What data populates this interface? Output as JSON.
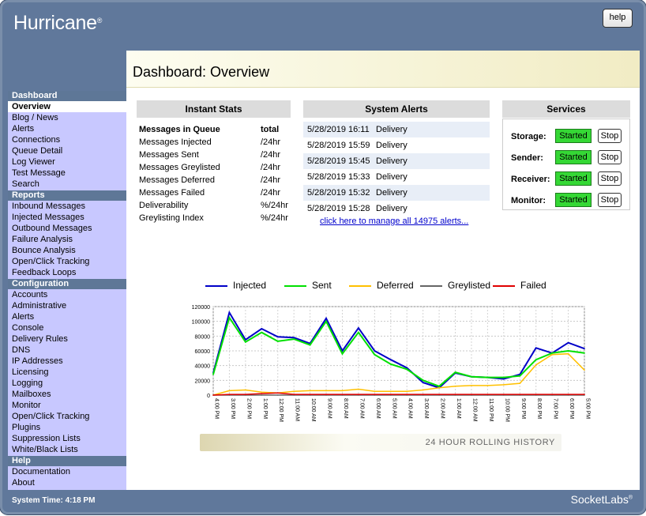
{
  "app": {
    "logo": "Hurricane",
    "logo_mark": "®",
    "help": "help",
    "brand": "SocketLabs",
    "brand_mark": "®",
    "system_time": "System Time: 4:18 PM"
  },
  "page": {
    "title": "Dashboard: Overview"
  },
  "sidebar": [
    {
      "title": "Dashboard",
      "items": [
        "Overview",
        "Blog / News",
        "Alerts",
        "Connections",
        "Queue Detail",
        "Log Viewer",
        "Test Message",
        "Search"
      ],
      "active": "Overview"
    },
    {
      "title": "Reports",
      "items": [
        "Inbound Messages",
        "Injected Messages",
        "Outbound Messages",
        "Failure Analysis",
        "Bounce Analysis",
        "Open/Click Tracking",
        "Feedback Loops"
      ]
    },
    {
      "title": "Configuration",
      "items": [
        "Accounts",
        "Administrative",
        "Alerts",
        "Console",
        "Delivery Rules",
        "DNS",
        "IP Addresses",
        "Licensing",
        "Logging",
        "Mailboxes",
        "Monitor",
        "Open/Click Tracking",
        "Plugins",
        "Suppression Lists",
        "White/Black Lists"
      ]
    },
    {
      "title": "Help",
      "items": [
        "Documentation",
        "About"
      ]
    }
  ],
  "instant_stats": {
    "title": "Instant Stats",
    "rows": [
      {
        "label": "Messages in Queue",
        "value": "total",
        "bold": true
      },
      {
        "label": "Messages Injected",
        "value": "/24hr"
      },
      {
        "label": "Messages Sent",
        "value": "/24hr"
      },
      {
        "label": "Messages Greylisted",
        "value": "/24hr"
      },
      {
        "label": "Messages Deferred",
        "value": "/24hr"
      },
      {
        "label": "Messages Failed",
        "value": "/24hr"
      },
      {
        "label": "Deliverability",
        "value": "%/24hr"
      },
      {
        "label": "Greylisting Index",
        "value": "%/24hr"
      }
    ]
  },
  "system_alerts": {
    "title": "System Alerts",
    "rows": [
      {
        "date": "5/28/2019 16:11",
        "type": "Delivery"
      },
      {
        "date": "5/28/2019 15:59",
        "type": "Delivery"
      },
      {
        "date": "5/28/2019 15:45",
        "type": "Delivery"
      },
      {
        "date": "5/28/2019 15:33",
        "type": "Delivery"
      },
      {
        "date": "5/28/2019 15:32",
        "type": "Delivery"
      },
      {
        "date": "5/28/2019 15:28",
        "type": "Delivery"
      }
    ],
    "link": "click here to manage all 14975 alerts..."
  },
  "services": {
    "title": "Services",
    "rows": [
      {
        "name": "Storage:",
        "status": "Started",
        "stop": "Stop"
      },
      {
        "name": "Sender:",
        "status": "Started",
        "stop": "Stop"
      },
      {
        "name": "Receiver:",
        "status": "Started",
        "stop": "Stop"
      },
      {
        "name": "Monitor:",
        "status": "Started",
        "stop": "Stop"
      }
    ]
  },
  "rolling_label": "24 HOUR ROLLING HISTORY",
  "chart_data": {
    "type": "line",
    "categories": [
      "4:00 PM",
      "3:00 PM",
      "2:00 PM",
      "1:00 PM",
      "12:00 PM",
      "11:00 AM",
      "10:00 AM",
      "9:00 AM",
      "8:00 AM",
      "7:00 AM",
      "6:00 AM",
      "5:00 AM",
      "4:00 AM",
      "3:00 AM",
      "2:00 AM",
      "1:00 AM",
      "12:00 AM",
      "11:00 PM",
      "10:00 PM",
      "9:00 PM",
      "8:00 PM",
      "7:00 PM",
      "6:00 PM",
      "5:00 PM"
    ],
    "series": [
      {
        "name": "Injected",
        "color": "#0000c8",
        "values": [
          30000,
          112000,
          75000,
          90000,
          79000,
          78000,
          70000,
          104000,
          60000,
          91000,
          60000,
          48000,
          37000,
          17000,
          10000,
          30000,
          25000,
          24000,
          22000,
          28000,
          64000,
          57000,
          71000,
          63000
        ]
      },
      {
        "name": "Sent",
        "color": "#00e000",
        "values": [
          28000,
          105000,
          72000,
          85000,
          73000,
          76000,
          68000,
          100000,
          56000,
          85000,
          55000,
          42000,
          35000,
          20000,
          12000,
          31000,
          25000,
          24000,
          24000,
          26000,
          48000,
          57000,
          60000,
          57000
        ]
      },
      {
        "name": "Deferred",
        "color": "#ffc000",
        "values": [
          0,
          6000,
          7000,
          4000,
          3000,
          5000,
          6000,
          6000,
          6000,
          8000,
          5000,
          5000,
          5000,
          7000,
          10000,
          12000,
          13000,
          13000,
          14000,
          16000,
          41000,
          55000,
          56000,
          34000
        ]
      },
      {
        "name": "Greylisted",
        "color": "#666666",
        "values": [
          0,
          0,
          0,
          0,
          0,
          0,
          0,
          0,
          0,
          0,
          0,
          0,
          0,
          0,
          0,
          0,
          0,
          0,
          0,
          0,
          0,
          0,
          0,
          0
        ]
      },
      {
        "name": "Failed",
        "color": "#e00000",
        "values": [
          0,
          1000,
          1000,
          2000,
          3000,
          1000,
          1000,
          1000,
          1000,
          1000,
          1000,
          1000,
          1000,
          1000,
          1000,
          1000,
          1000,
          1000,
          1000,
          1000,
          1000,
          1000,
          1000,
          1000
        ]
      }
    ],
    "yticks": [
      0,
      20000,
      40000,
      60000,
      80000,
      100000,
      120000
    ],
    "ylim": [
      0,
      120000
    ],
    "grid": true,
    "legend_position": "top"
  }
}
